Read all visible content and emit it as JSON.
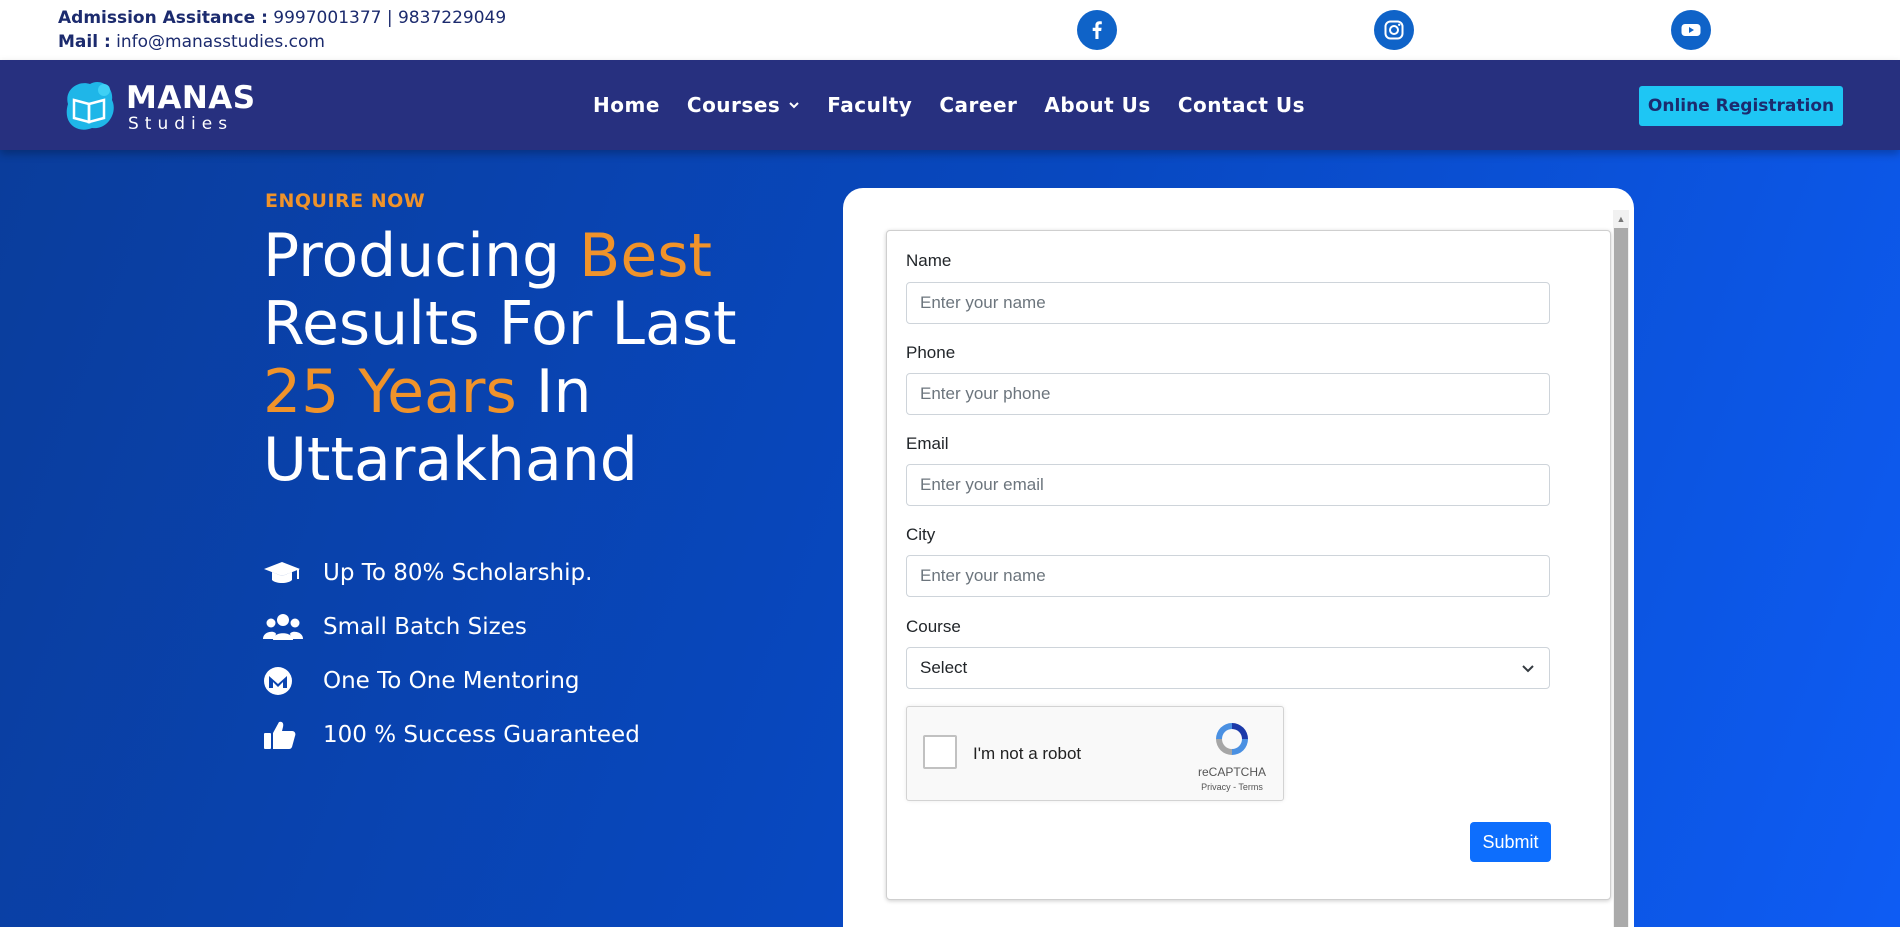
{
  "topbar": {
    "admission_label": "Admission Assitance :",
    "admission_phones": "9997001377 | 9837229049",
    "mail_label": "Mail :",
    "mail_value": "info@manasstudies.com",
    "social": [
      "facebook-icon",
      "instagram-icon",
      "youtube-icon"
    ]
  },
  "navbar": {
    "logo_title": "MANAS",
    "logo_sub": "Studies",
    "items": [
      {
        "label": "Home"
      },
      {
        "label": "Courses",
        "has_dropdown": true
      },
      {
        "label": "Faculty"
      },
      {
        "label": "Career"
      },
      {
        "label": "About Us"
      },
      {
        "label": "Contact Us"
      }
    ],
    "register_label": "Online Registration"
  },
  "hero": {
    "eyebrow": "ENQUIRE NOW",
    "headline": {
      "p1": "Producing ",
      "p2": "Best",
      "p3": "Results For Last",
      "p4": "25 Years",
      "p5": " In",
      "p6": "Uttarakhand"
    },
    "features": [
      {
        "icon": "graduation-cap-icon",
        "text": "Up To 80% Scholarship."
      },
      {
        "icon": "users-icon",
        "text": "Small Batch Sizes"
      },
      {
        "icon": "mentor-icon",
        "text": "One To One Mentoring"
      },
      {
        "icon": "thumbs-up-icon",
        "text": "100 % Success Guaranteed"
      }
    ]
  },
  "form": {
    "fields": [
      {
        "label": "Name",
        "placeholder": "Enter your name"
      },
      {
        "label": "Phone",
        "placeholder": "Enter your phone"
      },
      {
        "label": "Email",
        "placeholder": "Enter your email"
      },
      {
        "label": "City",
        "placeholder": "Enter your name"
      }
    ],
    "course": {
      "label": "Course",
      "selected": "Select"
    },
    "captcha": {
      "text": "I'm not a robot",
      "brand": "reCAPTCHA",
      "links": "Privacy - Terms"
    },
    "submit_label": "Submit"
  },
  "colors": {
    "accent_orange": "#f0932a",
    "navbar": "#27307f",
    "cta": "#1ec6f4",
    "submit": "#0d6efd"
  }
}
